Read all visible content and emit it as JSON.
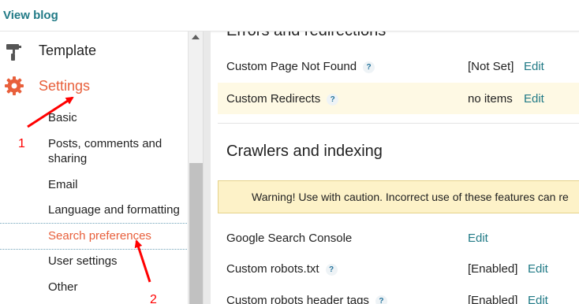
{
  "topbar": {
    "view_blog": "View blog"
  },
  "sidebar": {
    "main_items": [
      {
        "label": "Template",
        "icon": "paint-roller-icon"
      },
      {
        "label": "Settings",
        "icon": "gear-icon"
      }
    ],
    "sub_items": [
      "Basic",
      "Posts, comments and sharing",
      "Email",
      "Language and formatting",
      "Search preferences",
      "User settings",
      "Other"
    ],
    "active_sub_item": "Search preferences"
  },
  "main": {
    "errors_title": "Errors and redirections",
    "errors_rows": [
      {
        "label": "Custom Page Not Found",
        "value": "[Not Set]",
        "edit": "Edit"
      },
      {
        "label": "Custom Redirects",
        "value": "no items",
        "edit": "Edit"
      }
    ],
    "crawlers_title": "Crawlers and indexing",
    "warning": "Warning! Use with caution. Incorrect use of these features can re",
    "crawlers_rows": [
      {
        "label": "Google Search Console",
        "value": "",
        "edit": "Edit"
      },
      {
        "label": "Custom robots.txt",
        "value": "[Enabled]",
        "edit": "Edit"
      },
      {
        "label": "Custom robots header tags",
        "value": "[Enabled]",
        "edit": "Edit"
      }
    ],
    "help_symbol": "?"
  },
  "annotations": {
    "arrow_1": "1",
    "arrow_2": "2"
  },
  "colors": {
    "accent": "#e8603c",
    "link": "#217a86",
    "annotation": "#ff0000"
  }
}
